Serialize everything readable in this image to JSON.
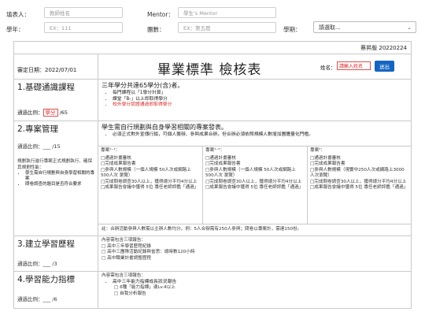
{
  "form": {
    "filler_label": "填表人：",
    "filler_placeholder": "教師姓名",
    "mentor_label": "Mentor：",
    "mentor_placeholder": "學生's Mentor",
    "year_label": "學年：",
    "year_placeholder": "EX：111",
    "team_label": "團數：",
    "team_placeholder": "EX：第五屆",
    "term_label": "學期：",
    "term_value": "請選取..."
  },
  "sheet": {
    "version": "蔡昇版 20220224",
    "review_date": "審定日期：2022/07/01",
    "title": "畢業標準 檢核表",
    "name_label": "姓名：",
    "name_placeholder": "請輸入姓名",
    "submit_label": "送出"
  },
  "sections": [
    {
      "title": "1.基礎通識課程",
      "ratio_prefix": "通過比例：",
      "ratio_value": "學分",
      "ratio_suffix": " /65",
      "heading": "三年學分共達65學分(含)者。",
      "items": [
        "每門課程以「1學分計算」",
        "課堂「B-」以上即取得學分",
        "校外學分認證通過即取得學分"
      ]
    },
    {
      "title": "2.專案管理",
      "ratio": "通過比例：___ /15",
      "heading": "學生需自行規劃與自身學習相關的專案發表。",
      "items": [
        "必須正式對外宣傳行銷，可個人籌辦、參與成果合辦，但合辦必須依照規模人數增加團體量化門檻。"
      ],
      "side_note": "規劃執行進行專案正式規劃執行、確保其規劃性能：",
      "side_items": [
        "學生需自行規劃與自身學習相關的專案",
        "問卷調查的題目是否符合要求"
      ],
      "col1_title": "專案¹⁻¹：",
      "col1": [
        "□通過計畫審核",
        "□完成成果報告書",
        "□參與人數規模（一個人規模 50人次或網路上 500人次 瀏覽）",
        "□完成問卷調查30人以上，獲得總分平均4分以上",
        "□成果報告會議中獲得 5位 專任老師評鑑「通過」"
      ],
      "col2_title": "專案¹⁻²：",
      "col2": [
        "□通過計畫審核",
        "□完成成果報告書",
        "□參與人數規模（一個人規模 50人次或網路上 500人次 瀏覽）",
        "□完成問卷調查30人以上，獲得總分平均4分以上",
        "□成果報告會議中獲得 5位 專任老師評鑑「通過」"
      ],
      "col3_title": "專案²：",
      "col3": [
        "□通過計畫審核",
        "□完成成果報告書",
        "□參與人數規模（現實中250人次或網路上3000人次瀏覽）",
        "□完成問卷調查30人以上，獲得總分平均4分以上",
        "□成果報告會議中獲得 5位 專任老師評鑑「通過」"
      ],
      "note": "註：合辦活動參與人數需以主辦人數均分。例：5人合辦需有250人參與；問卷以專案計，需達150份。"
    },
    {
      "title": "3.建立學習歷程",
      "ratio": "通過比例：___ /3",
      "heading": "內容需包含三項報告：",
      "items": [
        "□ 高中三年學習歷程紀錄",
        "□ 高中三團隊活動紀錄與省思：總時數120小時",
        "□ 高中職業計畫調整歷程"
      ]
    },
    {
      "title": "4.學習能力指標",
      "ratio": "通過比例：___ /6",
      "heading": "內容需包含三項報告：",
      "items": [
        "高中三年能力指標成長狀況報告",
        "□ 6種「能力指標」達Lv.4以上",
        "□ 自我分析報告"
      ]
    }
  ]
}
